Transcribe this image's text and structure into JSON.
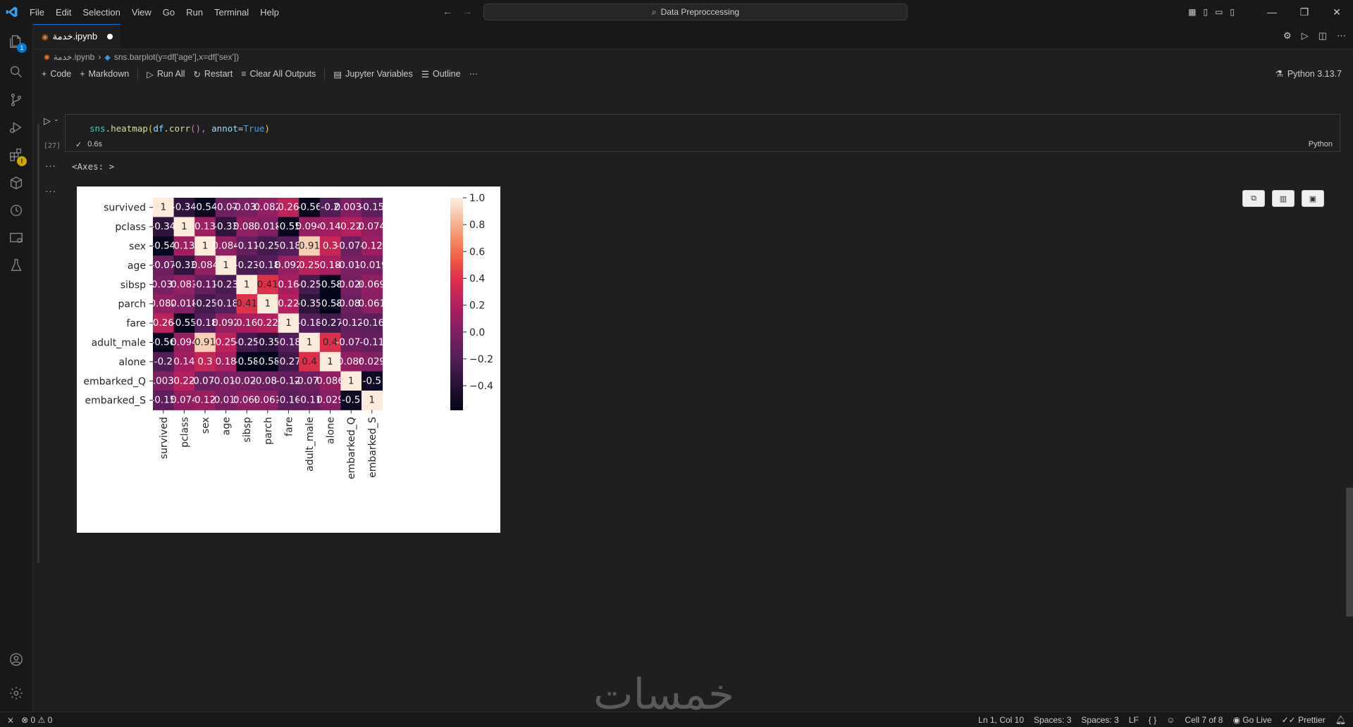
{
  "menu": [
    "File",
    "Edit",
    "Selection",
    "View",
    "Go",
    "Run",
    "Terminal",
    "Help"
  ],
  "search": {
    "text": "Data Preproccessing"
  },
  "tab": {
    "label": "خدمة.ipynb"
  },
  "breadcrumb": {
    "file": "خدمة.ipynb",
    "cell": "sns.barplot(y=df['age'],x=df['sex'])"
  },
  "toolbar": {
    "code": "Code",
    "markdown": "Markdown",
    "run_all": "Run All",
    "restart": "Restart",
    "clear": "Clear All Outputs",
    "variables": "Jupyter Variables",
    "outline": "Outline",
    "more": "···",
    "kernel": "Python 3.13.7"
  },
  "cell": {
    "exec_count": "[27]",
    "code_parts": {
      "obj": "sns",
      "dot": ".",
      "fn": "heatmap",
      "open": "(",
      "df": "df",
      "dot2": ".",
      "corr": "corr",
      "args": "(), ",
      "kw": "annot",
      "eq": "=",
      "val": "True",
      "close": ")"
    },
    "time": "0.6s",
    "language": "Python",
    "output_text": "<Axes: >"
  },
  "activity_badge": "1",
  "chart_data": {
    "type": "heatmap",
    "rows": [
      "survived",
      "pclass",
      "sex",
      "age",
      "sibsp",
      "parch",
      "fare",
      "adult_male",
      "alone",
      "embarked_Q",
      "embarked_S"
    ],
    "cols": [
      "survived",
      "pclass",
      "sex",
      "age",
      "sibsp",
      "parch",
      "fare",
      "adult_male",
      "alone",
      "embarked_Q",
      "embarked_S"
    ],
    "values": [
      [
        1,
        -0.34,
        -0.54,
        -0.07,
        -0.035,
        0.082,
        0.26,
        -0.56,
        -0.2,
        0.0037,
        -0.15
      ],
      [
        -0.34,
        1,
        0.13,
        -0.33,
        0.083,
        0.018,
        -0.55,
        0.094,
        0.14,
        0.22,
        0.074
      ],
      [
        -0.54,
        0.13,
        1,
        0.084,
        -0.11,
        -0.25,
        -0.18,
        0.91,
        0.3,
        -0.074,
        0.12
      ],
      [
        -0.07,
        -0.33,
        0.084,
        1,
        -0.23,
        -0.18,
        0.092,
        0.25,
        0.18,
        -0.014,
        -0.019
      ],
      [
        -0.035,
        0.083,
        -0.11,
        -0.23,
        1,
        0.41,
        0.16,
        -0.25,
        -0.58,
        -0.026,
        0.069
      ],
      [
        0.082,
        0.018,
        -0.25,
        -0.18,
        0.41,
        1,
        0.22,
        -0.35,
        -0.58,
        -0.081,
        0.061
      ],
      [
        0.26,
        -0.55,
        -0.18,
        0.092,
        0.16,
        0.22,
        1,
        -0.18,
        -0.27,
        -0.12,
        -0.16
      ],
      [
        -0.56,
        0.094,
        0.91,
        0.25,
        -0.25,
        -0.35,
        -0.18,
        1,
        0.4,
        -0.077,
        -0.11
      ],
      [
        -0.2,
        0.14,
        0.3,
        0.18,
        -0.58,
        -0.58,
        -0.27,
        0.4,
        1,
        0.086,
        0.029
      ],
      [
        0.0037,
        0.22,
        -0.074,
        -0.014,
        -0.026,
        -0.081,
        -0.12,
        -0.077,
        0.086,
        1,
        -0.5
      ],
      [
        -0.15,
        0.074,
        0.12,
        -0.019,
        0.069,
        0.061,
        -0.16,
        -0.11,
        0.029,
        -0.5,
        1
      ]
    ],
    "vmin": -0.58,
    "vmax": 1.0,
    "colorbar_ticks": [
      "1.0",
      "0.8",
      "0.6",
      "0.4",
      "0.2",
      "0.0",
      "−0.2",
      "−0.4"
    ],
    "colorbar_values": [
      1.0,
      0.8,
      0.6,
      0.4,
      0.2,
      0.0,
      -0.2,
      -0.4
    ],
    "colormap": "rocket"
  },
  "statusbar": {
    "errors": "0",
    "warnings": "0",
    "position": "Ln 1, Col 10",
    "spaces1": "Spaces: 3",
    "spaces2": "Spaces: 3",
    "eol": "LF",
    "braces": "{ }",
    "cell": "Cell 7 of 8",
    "golive": "Go Live",
    "prettier": "Prettier"
  },
  "watermark": "خمسات"
}
